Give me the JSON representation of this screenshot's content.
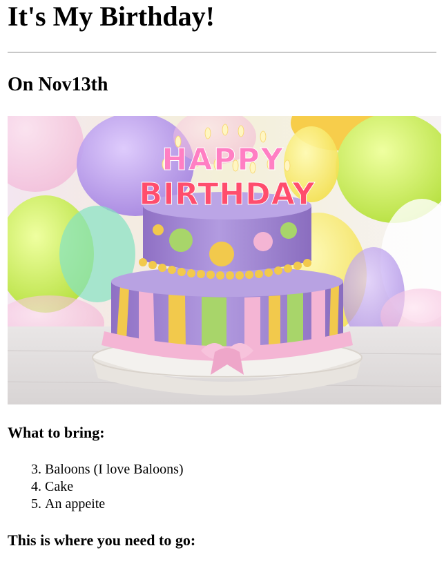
{
  "page": {
    "title": "It's My Birthday!",
    "date_heading": "On Nov13th",
    "photo_alt": "Birthday cake",
    "cake_topper": {
      "line1": "HAPPY",
      "line2": "BIRTHDAY"
    },
    "bring_heading": "What to bring:",
    "bring_list_start": 3,
    "bring_items": [
      "Baloons (I love Baloons)",
      "Cake",
      "An appeite"
    ],
    "go_heading": "This is where you need to go:"
  },
  "colors": {
    "cake_purple": "#a98ad6",
    "frosting_pink": "#f4b5d4",
    "stripe_yellow": "#f2c94c",
    "stripe_green": "#a8d56a"
  }
}
